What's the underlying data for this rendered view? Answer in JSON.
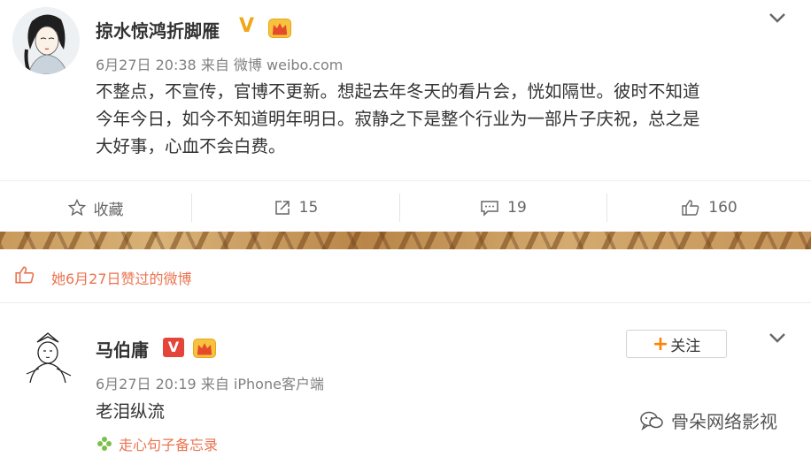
{
  "post1": {
    "author": "掠水惊鸿折脚雁",
    "verified_mark": "V",
    "time": "6月27日 20:38",
    "source": "来自 微博 weibo.com",
    "content_lines": [
      "不整点，不宣传，官博不更新。想起去年冬天的看片会，恍如隔世。彼时不知道",
      "今年今日，如今不知道明年明日。寂静之下是整个行业为一部片子庆祝，总之是",
      "大好事，心血不会白费。"
    ],
    "actions": {
      "favorite_label": "收藏",
      "repost_count": "15",
      "comment_count": "19",
      "like_count": "160"
    }
  },
  "like_notice": {
    "text": "她6月27日赞过的微博"
  },
  "post2": {
    "author": "马伯庸",
    "verified_mark": "V",
    "follow_label": "关注",
    "follow_plus": "+",
    "time": "6月27日 20:19",
    "source": "来自 iPhone客户端",
    "content": "老泪纵流",
    "source_link": "走心句子备忘录"
  },
  "watermark": {
    "text": "骨朵网络影视"
  },
  "colors": {
    "accent_orange": "#eb7350",
    "verified_gold": "#f0a718",
    "verified_red": "#e5443a",
    "follow_plus": "#ff8200"
  }
}
